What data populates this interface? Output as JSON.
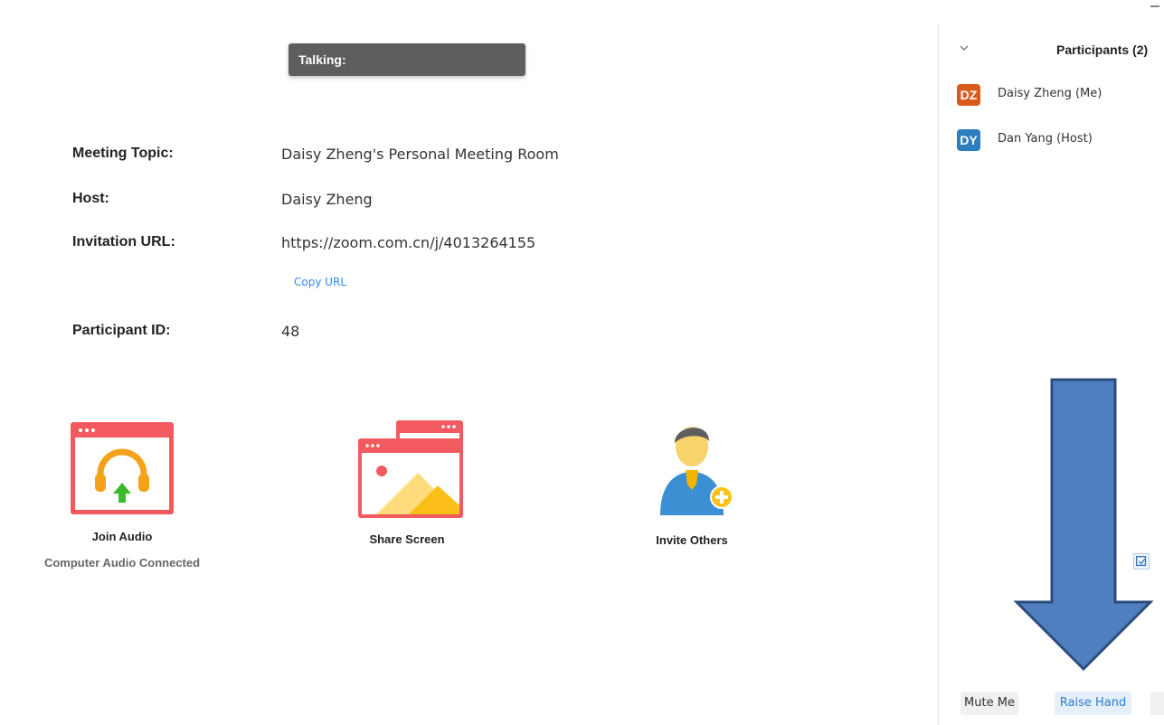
{
  "talking": {
    "label": "Talking:"
  },
  "meeting": {
    "topic_label": "Meeting Topic:",
    "topic_value": "Daisy Zheng's Personal Meeting Room",
    "host_label": "Host:",
    "host_value": "Daisy Zheng",
    "url_label": "Invitation URL:",
    "url_value": "https://zoom.com.cn/j/4013264155",
    "copy_url": "Copy URL",
    "pid_label": "Participant ID:",
    "pid_value": "48"
  },
  "actions": {
    "join_audio": {
      "label": "Join Audio",
      "sublabel": "Computer Audio Connected",
      "icon": "headphones-icon"
    },
    "share_screen": {
      "label": "Share Screen",
      "icon": "share-screen-icon"
    },
    "invite_others": {
      "label": "Invite Others",
      "icon": "invite-person-icon"
    }
  },
  "participants": {
    "title": "Participants (2)",
    "list": [
      {
        "initials": "DZ",
        "name": "Daisy Zheng (Me)",
        "color": "#d95b1b"
      },
      {
        "initials": "DY",
        "name": "Dan Yang (Host)",
        "color": "#2e7dbd"
      }
    ],
    "buttons": {
      "mute_me": "Mute Me",
      "raise_hand": "Raise Hand"
    }
  },
  "colors": {
    "accent": "#2d8cff",
    "icon_red": "#f25a5f",
    "arrow_fill": "#4f7fbf",
    "arrow_stroke": "#2c4d7e"
  }
}
